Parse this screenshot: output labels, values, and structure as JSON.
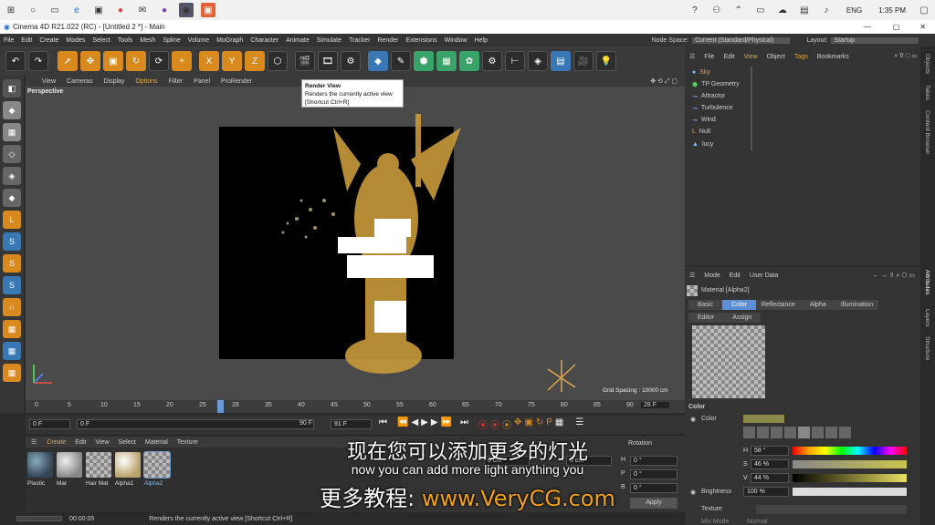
{
  "taskbar": {
    "lang": "ENG",
    "time": "1:35 PM"
  },
  "window": {
    "title": "Cinema 4D R21.022 (RC) - [Untitled 2 *] - Main"
  },
  "menubar": {
    "items": [
      "File",
      "Edit",
      "Create",
      "Modes",
      "Select",
      "Tools",
      "Mesh",
      "Spline",
      "Volume",
      "MoGraph",
      "Character",
      "Animate",
      "Simulate",
      "Tracker",
      "Render",
      "Extensions",
      "Window",
      "Help"
    ],
    "node_space_label": "Node Space:",
    "node_space_value": "Current (Standard/Physical)",
    "layout_label": "Layout:",
    "layout_value": "Startup"
  },
  "viewport": {
    "menu": [
      "View",
      "Cameras",
      "Display",
      "Options",
      "Filter",
      "Panel",
      "ProRender"
    ],
    "name": "Perspective",
    "grid_spacing": "Grid Spacing : 10000 cm"
  },
  "tooltip": {
    "title": "Render View",
    "line1": "Renders the currently active view",
    "line2": "[Shortcut Ctrl+R]"
  },
  "timeline": {
    "ticks": [
      "0",
      "5",
      "10",
      "15",
      "20",
      "25",
      "28",
      "35",
      "40",
      "45",
      "50",
      "55",
      "60",
      "65",
      "70",
      "75",
      "80",
      "85",
      "90"
    ],
    "current": "28 F"
  },
  "controls": {
    "start": "0 F",
    "start2": "0 F",
    "end": "90 F",
    "end2": "91 F"
  },
  "materials": {
    "menu": [
      "Create",
      "Edit",
      "View",
      "Select",
      "Material",
      "Texture"
    ],
    "items": [
      "Plastic",
      "Mat",
      "Hair Mat",
      "Alpha1",
      "Alpha2"
    ]
  },
  "coord": {
    "rotation": "Rotation",
    "h_label": "H",
    "h": "0 °",
    "p_label": "P",
    "p": "0 °",
    "b_label": "B",
    "b": "0 °",
    "x_size": "0 cm",
    "y_size": "0 cm",
    "apply": "Apply"
  },
  "status": {
    "time": "00:00:05",
    "message": "Renders the currently active view [Shortcut Ctrl+R]"
  },
  "objects": {
    "menu": [
      "File",
      "Edit",
      "View",
      "Object",
      "Tags",
      "Bookmarks"
    ],
    "rows": [
      "Sky",
      "TP Geometry",
      "Attractor",
      "Turbulence",
      "Wind",
      "Null",
      "lucy"
    ]
  },
  "attributes": {
    "menu": [
      "Mode",
      "Edit",
      "User Data"
    ],
    "material_name": "Material [Alpha2]",
    "tabs": [
      "Basic",
      "Color",
      "Reflectance",
      "Alpha",
      "Illumination"
    ],
    "tabs2": [
      "Editor",
      "Assign"
    ],
    "section": "Color",
    "color_label": "Color",
    "h_label": "H",
    "h": "58 °",
    "s_label": "S",
    "s": "46 %",
    "v_label": "V",
    "v": "44 %",
    "brightness_label": "Brightness",
    "brightness": "100 %",
    "texture_label": "Texture",
    "mix_label": "Mix Mode",
    "mix_value": "Normal"
  },
  "sidetabs": [
    "Objects",
    "Takes",
    "Content Browser",
    "Attributes",
    "Layers",
    "Structure"
  ],
  "subtitles": {
    "zh": "现在您可以添加更多的灯光",
    "en": "now you can add more light anything you",
    "brand_zh": "更多教程:",
    "brand_url": "www.VeryCG.com"
  },
  "colors": {
    "accent": "#d98a1f",
    "swatch": "#8c8a4a"
  }
}
